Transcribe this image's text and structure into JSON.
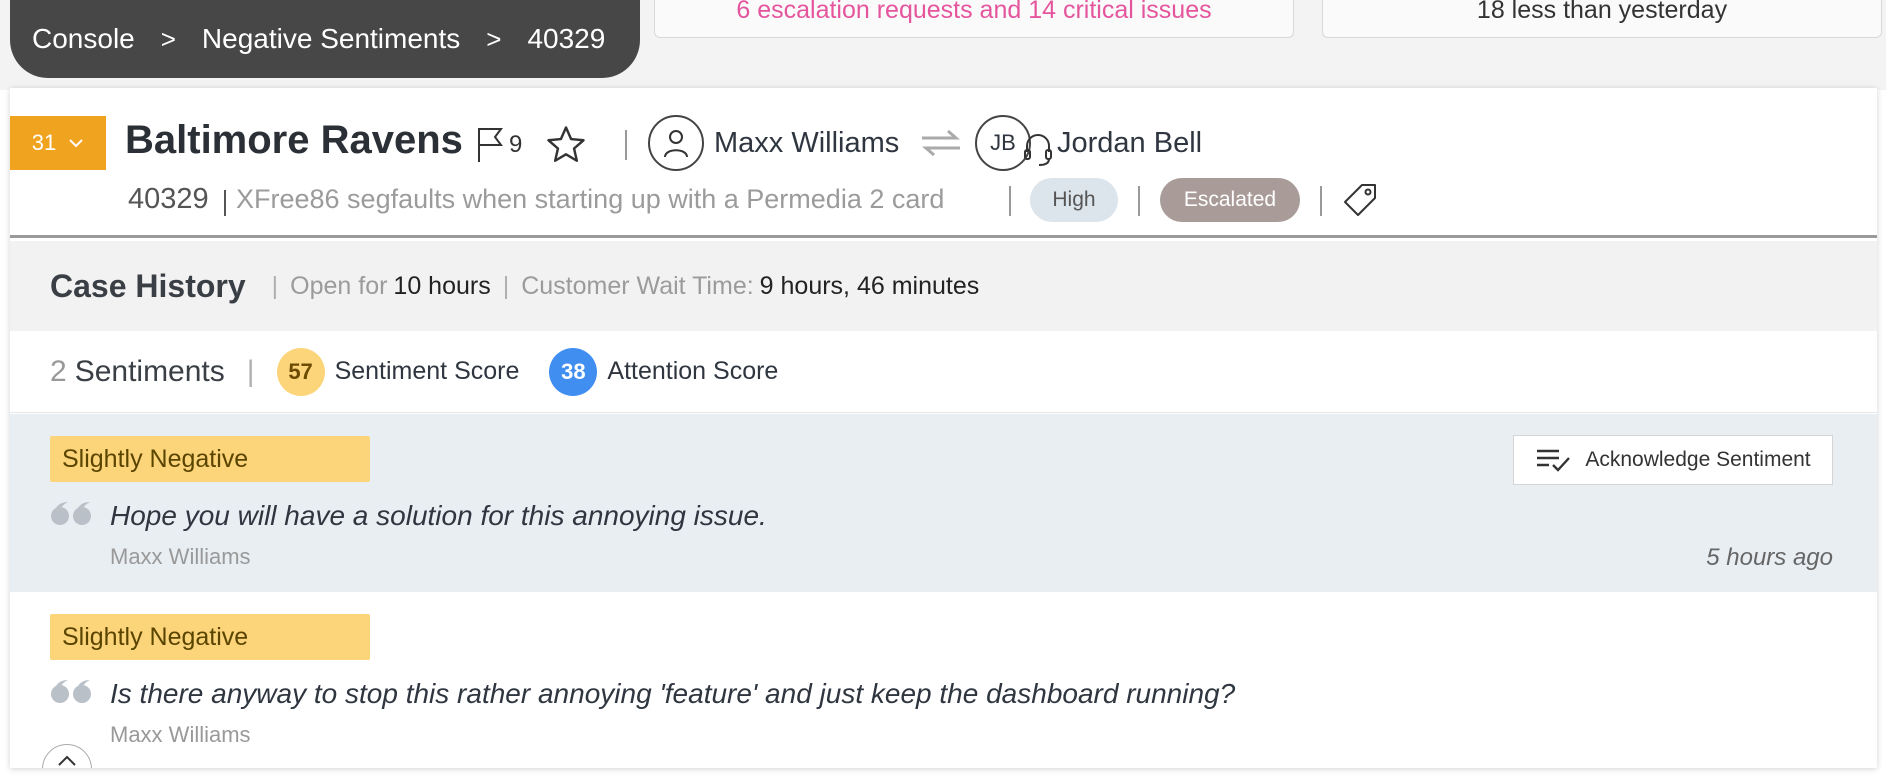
{
  "background": {
    "card_a": "6 escalation requests and 14 critical issues",
    "card_b": "18 less than yesterday"
  },
  "breadcrumb": [
    "Console",
    "Negative Sentiments",
    "40329"
  ],
  "header": {
    "count": "31",
    "title": "Baltimore Ravens",
    "flag_count": "9",
    "customer": "Maxx Williams",
    "agent_initials": "JB",
    "agent": "Jordan Bell",
    "case_number": "40329",
    "case_desc": "XFree86 segfaults when starting up with a Permedia 2 card",
    "priority": "High",
    "status": "Escalated"
  },
  "case_history": {
    "title": "Case History",
    "open_label": "Open for",
    "open_value": "10 hours",
    "wait_label": "Customer Wait Time:",
    "wait_value": "9 hours, 46 minutes"
  },
  "scores": {
    "sentiment_count": "2",
    "sentiment_label": "Sentiments",
    "sentiment_score": "57",
    "sentiment_score_label": "Sentiment Score",
    "attention_score": "38",
    "attention_score_label": "Attention Score"
  },
  "sentiments": [
    {
      "tag": "Slightly Negative",
      "quote": "Hope you will have a solution for this annoying issue.",
      "author": "Maxx Williams",
      "time": "5 hours ago",
      "action": "Acknowledge Sentiment"
    },
    {
      "tag": "Slightly Negative",
      "quote": "Is there anyway to stop this rather annoying 'feature' and just keep the dashboard running?",
      "author": "Maxx Williams"
    }
  ],
  "colors": {
    "badge": "#f0a31f",
    "sentiment_tag": "#fcd47a",
    "attention": "#3f8ef0",
    "escalated": "#a89b98"
  }
}
